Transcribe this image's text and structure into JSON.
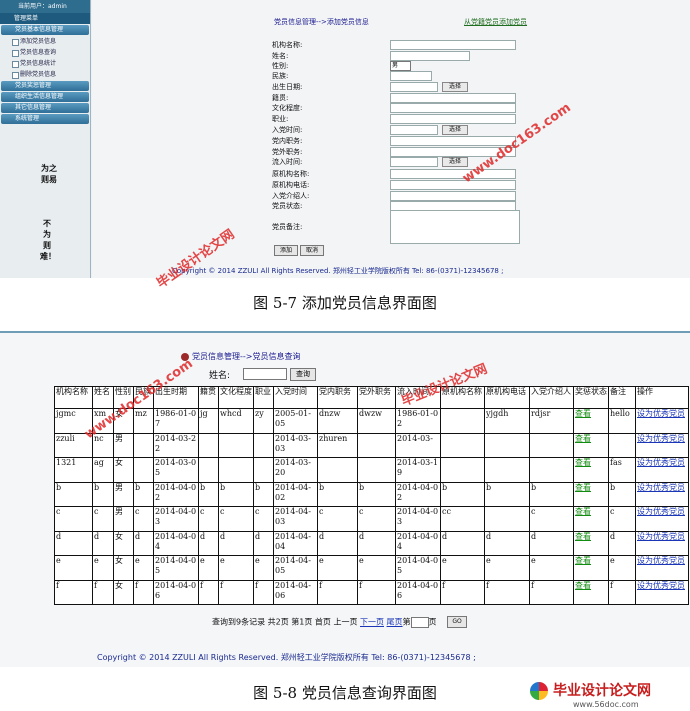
{
  "fig1": {
    "user_label": "当前用户：admin",
    "menu_head": "管理菜单",
    "groups": [
      {
        "label": "党员基本信息管理"
      },
      {
        "label": "党员奖惩管理"
      },
      {
        "label": "组织生活信息管理"
      },
      {
        "label": "其它信息管理"
      },
      {
        "label": "系统管理"
      }
    ],
    "sub_items": [
      "添加党员信息",
      "党员信息查询",
      "党员信息统计",
      "删除党员信息"
    ],
    "slogan1": "为之则易",
    "slogan2": "不为则难！",
    "breadcrumb": "党员信息管理-->添加党员信息",
    "right_link": "从党籍党员添加党员",
    "fields": {
      "org_name": "机构名称:",
      "name": "姓名:",
      "gender": "性别:",
      "ethnicity": "民族:",
      "birth": "出生日期:",
      "native": "籍贯:",
      "education": "文化程度:",
      "job": "职业:",
      "join_date": "入党时间:",
      "inner_post": "党内职务:",
      "outer_post": "党外职务:",
      "inflow_date": "流入时间:",
      "orig_org": "原机构名称:",
      "orig_phone": "原机构电话:",
      "introducer": "入党介绍人:",
      "status": "党员状态:",
      "remark": "党员备注:"
    },
    "gender_value": "男",
    "choose_label": "选择",
    "add_label": "添加",
    "cancel_label": "取消",
    "copyright": "Copyright © 2014 ZZULI All Rights Reserved.    郑州轻工业学院版权所有    Tel: 86-(0371)-12345678 ;"
  },
  "caption1": "图 5-7  添加党员信息界面图",
  "fig2": {
    "breadcrumb": "党员信息管理-->党员信息查询",
    "search_label": "姓名:",
    "search_button": "查询",
    "headers": [
      "机构名称",
      "姓名",
      "性别",
      "民族",
      "出生时期",
      "籍贯",
      "文化程度",
      "职业",
      "入党时间",
      "党内职务",
      "党外职务",
      "流入时间",
      "原机构名称",
      "原机构电话",
      "入党介绍人",
      "奖惩状态",
      "备注",
      "操作"
    ],
    "view_label": "查看",
    "op_label": "设为优秀党员",
    "rows": [
      [
        "jgmc",
        "xm",
        "女",
        "mz",
        "1986-01-07",
        "jg",
        "whcd",
        "zy",
        "2005-01-05",
        "dnzw",
        "dwzw",
        "1986-01-02",
        "",
        "yjgdh",
        "rdjsr",
        "查看",
        "hello",
        "设为优秀党员"
      ],
      [
        "zzuli",
        "nc",
        "男",
        "",
        "2014-03-22",
        "",
        "",
        "",
        "2014-03-03",
        "zhuren",
        "",
        "2014-03-",
        "",
        "",
        "",
        "查看",
        "",
        "设为优秀党员"
      ],
      [
        "1321",
        "ag",
        "女",
        "",
        "2014-03-05",
        "",
        "",
        "",
        "2014-03-20",
        "",
        "",
        "2014-03-19",
        "",
        "",
        "",
        "查看",
        "fas",
        "设为优秀党员"
      ],
      [
        "b",
        "b",
        "男",
        "b",
        "2014-04-02",
        "b",
        "b",
        "b",
        "2014-04-02",
        "b",
        "b",
        "2014-04-02",
        "b",
        "b",
        "b",
        "查看",
        "b",
        "设为优秀党员"
      ],
      [
        "c",
        "c",
        "男",
        "c",
        "2014-04-03",
        "c",
        "c",
        "c",
        "2014-04-03",
        "c",
        "c",
        "2014-04-03",
        "cc",
        "",
        "c",
        "查看",
        "c",
        "设为优秀党员"
      ],
      [
        "d",
        "d",
        "女",
        "d",
        "2014-04-04",
        "d",
        "d",
        "d",
        "2014-04-04",
        "d",
        "d",
        "2014-04-04",
        "d",
        "d",
        "d",
        "查看",
        "d",
        "设为优秀党员"
      ],
      [
        "e",
        "e",
        "女",
        "e",
        "2014-04-05",
        "e",
        "e",
        "e",
        "2014-04-05",
        "e",
        "e",
        "2014-04-05",
        "e",
        "e",
        "e",
        "查看",
        "e",
        "设为优秀党员"
      ],
      [
        "f",
        "f",
        "女",
        "f",
        "2014-04-06",
        "f",
        "f",
        "f",
        "2014-04-06",
        "f",
        "f",
        "2014-04-06",
        "f",
        "f",
        "f",
        "查看",
        "f",
        "设为优秀党员"
      ]
    ],
    "pager": {
      "summary": "查询到9条记录  共2页  第1页  首页  上一页",
      "next": "下一页",
      "last": "尾页",
      "jump_prefix": "第",
      "jump_suffix": "页",
      "go": "GO"
    },
    "copyright": "Copyright © 2014 ZZULI All Rights Reserved.    郑州轻工业学院版权所有    Tel: 86-(0371)-12345678 ;"
  },
  "caption2": "图 5-8  党员信息查询界面图",
  "watermarks": {
    "site_cn": "毕业设计论文网",
    "site_url1": "www.doc163.com",
    "site_url2": "www.56doc.com"
  }
}
